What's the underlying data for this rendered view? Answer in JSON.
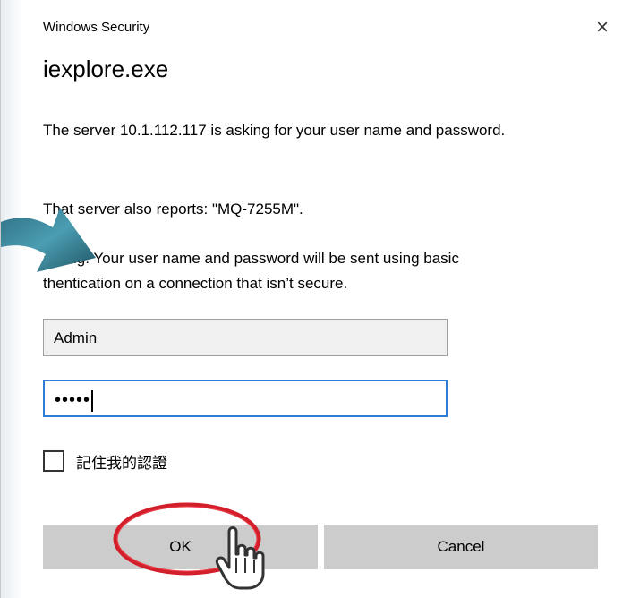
{
  "window": {
    "caption": "Windows Security",
    "close_symbol": "×"
  },
  "dialog": {
    "app_title": "iexplore.exe",
    "message": "The server 10.1.112.117 is asking for your user name and password.",
    "server_reports": "That server also reports: \"MQ-7255M\".",
    "warning": "arning: Your user name and password will be sent using basic\nthentication on a connection that isn’t secure."
  },
  "fields": {
    "username": "Admin",
    "password_mask": "•••••"
  },
  "remember": {
    "label": "記住我的認證",
    "checked": false
  },
  "buttons": {
    "ok": "OK",
    "cancel": "Cancel"
  },
  "icons": {
    "arrow": "teal-curved-arrow-icon",
    "highlight": "red-ellipse-highlight-icon",
    "pointer": "hand-pointer-icon"
  }
}
